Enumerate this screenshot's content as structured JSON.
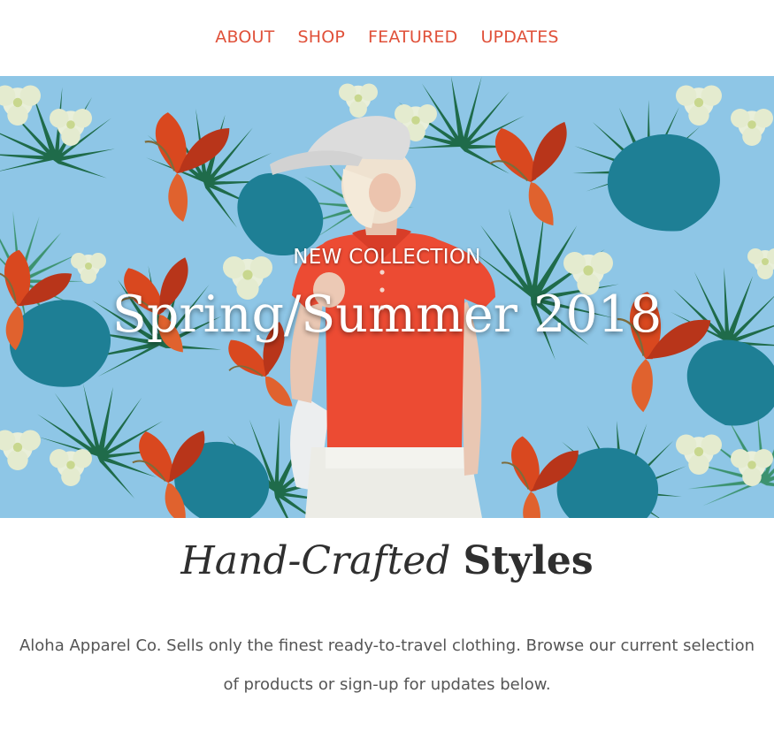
{
  "colors": {
    "nav_link": "#e0513a",
    "hero_sky": "#8ec6e6",
    "shirt": "#ec4b33",
    "text_dark": "#2f2f2f",
    "text_body": "#555555"
  },
  "nav": {
    "items": [
      {
        "label": "ABOUT"
      },
      {
        "label": "SHOP"
      },
      {
        "label": "FEATURED"
      },
      {
        "label": "UPDATES"
      }
    ]
  },
  "hero": {
    "eyebrow": "NEW COLLECTION",
    "title": "Spring/Summer 2018",
    "image_icon": "tropical-model-photo"
  },
  "section": {
    "headline_italic": "Hand-Crafted",
    "headline_bold": "Styles",
    "intro_line1": "Aloha Apparel Co. Sells only the finest ready-to-travel clothing. Browse our current selection",
    "intro_line2": "of products or sign-up for updates below."
  }
}
